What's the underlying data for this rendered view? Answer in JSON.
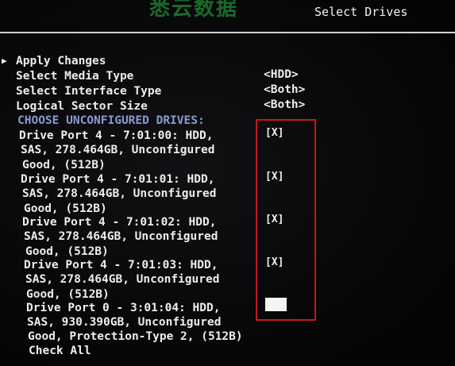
{
  "header": {
    "watermark": "悉云数据",
    "title": "Select Drives"
  },
  "menu": {
    "apply_changes": "Apply Changes",
    "media_type_label": "Select Media Type",
    "media_type_value": "<HDD>",
    "interface_type_label": "Select Interface Type",
    "interface_type_value": "<Both>",
    "sector_size_label": "Logical Sector Size",
    "sector_size_value": "<Both>",
    "section_heading": "CHOOSE UNCONFIGURED DRIVES:",
    "check_all": "Check All"
  },
  "drives": [
    {
      "line1": "Drive Port 4 - 7:01:00: HDD,",
      "line2": "SAS, 278.464GB, Unconfigured",
      "line3": "Good, (512B)",
      "checkbox": "[X]",
      "checked": true
    },
    {
      "line1": "Drive Port 4 - 7:01:01: HDD,",
      "line2": "SAS, 278.464GB, Unconfigured",
      "line3": "Good, (512B)",
      "checkbox": "[X]",
      "checked": true
    },
    {
      "line1": "Drive Port 4 - 7:01:02: HDD,",
      "line2": "SAS, 278.464GB, Unconfigured",
      "line3": "Good, (512B)",
      "checkbox": "[X]",
      "checked": true
    },
    {
      "line1": "Drive Port 4 - 7:01:03: HDD,",
      "line2": "SAS, 278.464GB, Unconfigured",
      "line3": "Good, (512B)",
      "checkbox": "[X]",
      "checked": true
    },
    {
      "line1": "Drive Port 0 - 3:01:04: HDD,",
      "line2": "SAS, 930.390GB, Unconfigured",
      "line3": "Good, Protection-Type 2, (512B)",
      "checkbox": "",
      "checked": false,
      "highlighted": true
    }
  ],
  "icons": {
    "cursor": "triangle-right-icon"
  },
  "colors": {
    "background": "#050505",
    "text": "#ededed",
    "section_heading": "#8a9bd0",
    "annotation_box": "#c41818",
    "watermark": "#1f7a2e"
  }
}
